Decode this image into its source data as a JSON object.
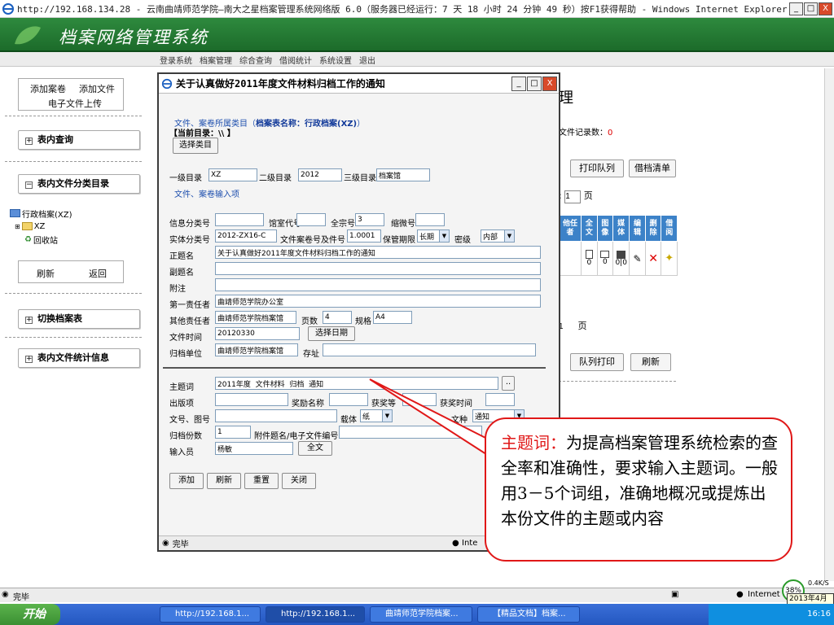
{
  "outer_window": {
    "title": "http://192.168.134.28 - 云南曲靖师范学院—南大之星档案管理系统网络版 6.0（服务器已经运行：7 天 18 小时 24 分钟 49 秒）按F1获得帮助 - Windows Internet Explorer",
    "min": "_",
    "max": "□",
    "close": "X"
  },
  "app": {
    "title": "档案网络管理系统",
    "menu": [
      "登录系统",
      "档案管理",
      "综合查询",
      "借阅统计",
      "系统设置",
      "退出"
    ]
  },
  "sidebar": {
    "add_case": "添加案卷",
    "add_file": "添加文件",
    "upload": "电子文件上传",
    "sections": {
      "query": "表内查询",
      "catalog": "表内文件分类目录",
      "switch": "切换档案表",
      "stats": "表内文件统计信息"
    },
    "tree": [
      "行政档案(XZ)",
      "XZ",
      "回收站"
    ],
    "refresh": "刷新",
    "back": "返回"
  },
  "background": {
    "title_frag": "理",
    "record_label": "文件记录数：",
    "record_count": "0",
    "print_queue": "打印队列",
    "borrow_list": "借档清单",
    "page_prefix": ":",
    "page_value": "1",
    "page_suffix": "页",
    "table_headers": [
      "他任者",
      "全文",
      "图像",
      "媒体",
      "编辑",
      "删除",
      "借阅"
    ],
    "table_cells": [
      "",
      "0",
      "0",
      "0|0",
      "",
      "",
      ""
    ],
    "page2_value": "1",
    "page2_suffix": "页",
    "queue_print": "队列打印",
    "refresh": "刷新"
  },
  "popup": {
    "title": "关于认真做好2011年度文件材料归档工作的通知",
    "category_label": "文件、案卷所属类目（",
    "category_name": "档案表名称：行政档案(XZ)",
    "category_end": "）",
    "current_dir": "【当前目录：\\\\ 】",
    "choose_btn": "选择类目",
    "level1_label": "一级目录",
    "level1": "XZ",
    "level2_label": "二级目录",
    "level2": "2012",
    "level3_label": "三级目录",
    "level3": "档案馆",
    "section_input": "文件、案卷输入项",
    "info_class_label": "信息分类号",
    "info_class": "",
    "room_code_label": "馆室代号",
    "room_code": "",
    "fonds_label": "全宗号",
    "fonds": "3",
    "micro_label": "缩微号",
    "micro": "",
    "entity_class_label": "实体分类号",
    "entity_class": "2012-ZX16-C",
    "volume_label": "文件案卷号及件号",
    "volume": "1.0001",
    "retention_label": "保管期限",
    "retention": "长期",
    "secret_label": "密级",
    "secret": "内部",
    "title_label": "正题名",
    "subtitle_label": "副题名",
    "subtitle": "",
    "note_label": "附注",
    "note": "",
    "first_resp_label": "第一责任者",
    "first_resp": "曲靖师范学院办公室",
    "other_resp_label": "其他责任者",
    "other_resp": "曲靖师范学院档案馆",
    "pages_label": "页数",
    "pages": "4",
    "spec_label": "规格",
    "spec": "A4",
    "date_label": "文件时间",
    "date": "20120330",
    "date_btn": "选择日期",
    "archive_unit_label": "归档单位",
    "archive_unit": "曲靖师范学院档案馆",
    "location_label": "存址",
    "location": "",
    "keyword_label": "主题词",
    "keyword": "2011年度  文件材料  归档  通知",
    "keyword_btn": "..",
    "publication_label": "出版项",
    "publication": "",
    "award_name_label": "奖励名称",
    "award_name": "",
    "award_num_label": "获奖等",
    "award_num": "",
    "award_time_label": "获奖时间",
    "award_time": "",
    "doc_num_label": "文号、图号",
    "doc_num": "",
    "carrier_label": "载体",
    "carrier": "纸",
    "doc_type_label": "文种",
    "doc_type": "通知",
    "copies_label": "归档份数",
    "copies": "1",
    "attach_label": "附件题名/电子文件编号",
    "attach": "",
    "operator_label": "输入员",
    "operator": "杨敏",
    "fulltext_btn": "全文",
    "buttons": {
      "add": "添加",
      "refresh": "刷新",
      "reset": "重置",
      "close": "关闭"
    },
    "status": "完毕",
    "status_zone": "Inte"
  },
  "callout": {
    "heading": "主题词：",
    "body": "为提高档案管理系统检索的查全率和准确性，要求输入主题词。一般用3－5个词组，准确地概况或提炼出本份文件的主题或内容"
  },
  "status_bar": {
    "text": "完毕",
    "zone": "Internet",
    "zoom": "38%",
    "date": "2013年4月19"
  },
  "taskbar": {
    "start": "开始",
    "tasks": [
      "http://192.168.1...",
      "http://192.168.1...",
      "曲靖师范学院档案...",
      "【精品文档】档案..."
    ],
    "time": "16:16",
    "net": "0.4K/S"
  },
  "colors": {
    "header_green": "#1c6b2a",
    "callout_red": "#e01818",
    "table_blue": "#3c82c8"
  }
}
